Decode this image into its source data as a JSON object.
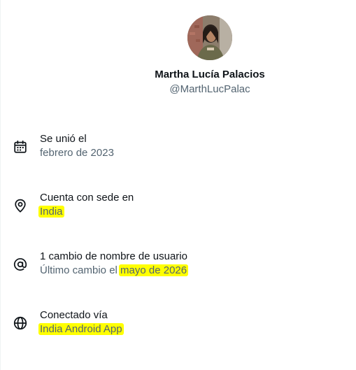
{
  "profile": {
    "display_name": "Martha Lucía Palacios",
    "handle": "@MarthLucPalac"
  },
  "about": {
    "joined": {
      "icon": "calendar-icon",
      "label": "Se unió el",
      "value": "febrero de 2023"
    },
    "location": {
      "icon": "location-pin-icon",
      "label": "Cuenta con sede en",
      "value": "India"
    },
    "username_changes": {
      "icon": "at-sign-icon",
      "label": "1 cambio de nombre de usuario",
      "value_prefix": "Último cambio el",
      "value": "mayo de 2026"
    },
    "connected_via": {
      "icon": "globe-icon",
      "label": "Conectado vía",
      "value": "India Android App"
    }
  },
  "colors": {
    "primary_text": "#0f1419",
    "secondary_text": "#536471",
    "highlight": "#ffff00"
  }
}
